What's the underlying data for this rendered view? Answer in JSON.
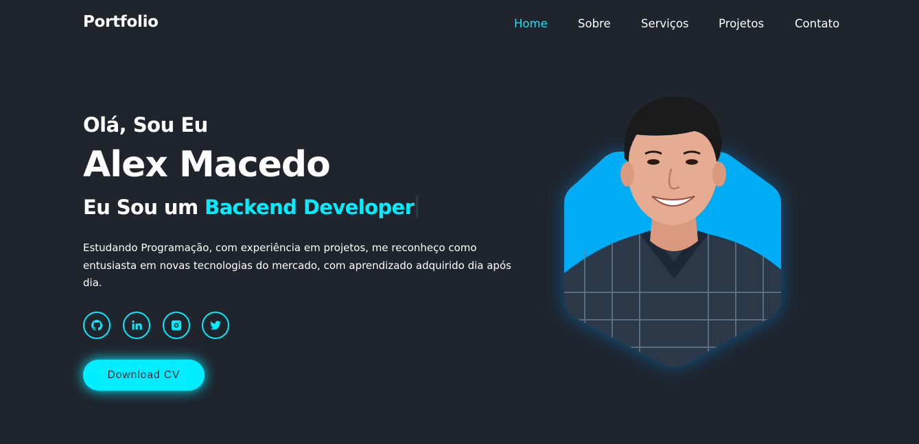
{
  "header": {
    "logo": "Portfolio",
    "nav": [
      {
        "label": "Home",
        "active": true
      },
      {
        "label": "Sobre",
        "active": false
      },
      {
        "label": "Serviços",
        "active": false
      },
      {
        "label": "Projetos",
        "active": false
      },
      {
        "label": "Contato",
        "active": false
      }
    ]
  },
  "hero": {
    "greeting": "Olá, Sou Eu",
    "name": "Alex Macedo",
    "role_prefix": "Eu Sou um",
    "role_highlight": "Backend Developer",
    "description": "Estudando Programação, com experiência em projetos, me reconheço como entusiasta em novas tecnologias do mercado, com aprendizado adquirido dia após dia.",
    "socials": [
      {
        "icon": "github-icon"
      },
      {
        "icon": "linkedin-icon"
      },
      {
        "icon": "instagram-icon"
      },
      {
        "icon": "twitter-icon"
      }
    ],
    "cta_label": "Download CV"
  },
  "colors": {
    "background": "#1f242d",
    "accent": "#00eeff",
    "photo_backdrop": "#00adf5",
    "text": "#ffffff"
  }
}
